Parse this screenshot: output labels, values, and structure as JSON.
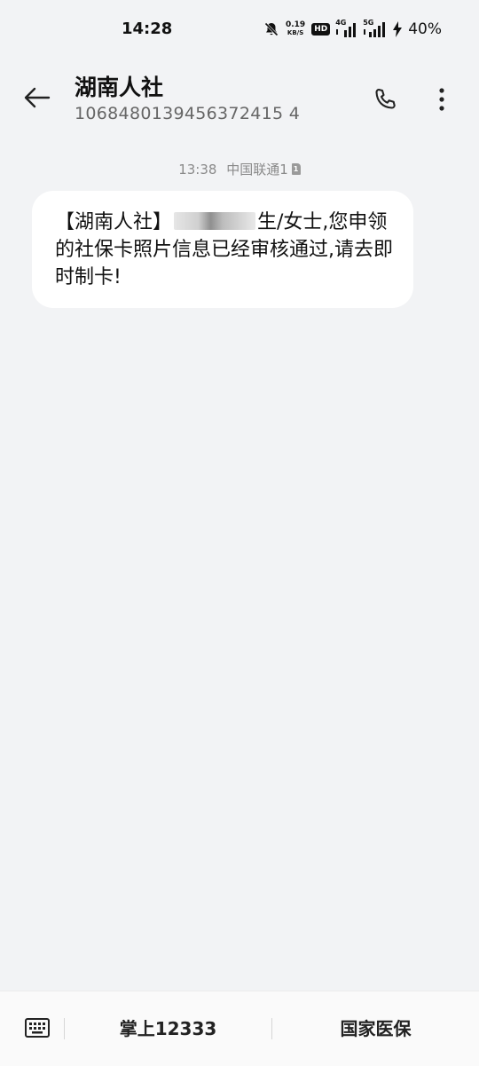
{
  "status_bar": {
    "time": "14:28",
    "net_speed_value": "0.19",
    "net_speed_unit": "KB/S",
    "hd_label": "HD",
    "signal1_label": "4G",
    "signal2_label": "5G",
    "battery": "40%"
  },
  "header": {
    "contact_name": "湖南人社",
    "contact_number": "1068480139456372415 4"
  },
  "message": {
    "time": "13:38",
    "carrier": "中国联通1",
    "text_prefix": "【湖南人社】",
    "text_after_redaction": "生/女士,您申领的社保卡照片信息已经审核通过,请去即时制卡!"
  },
  "bottom_bar": {
    "menu1_label": "掌上12333",
    "menu2_label": "国家医保"
  }
}
